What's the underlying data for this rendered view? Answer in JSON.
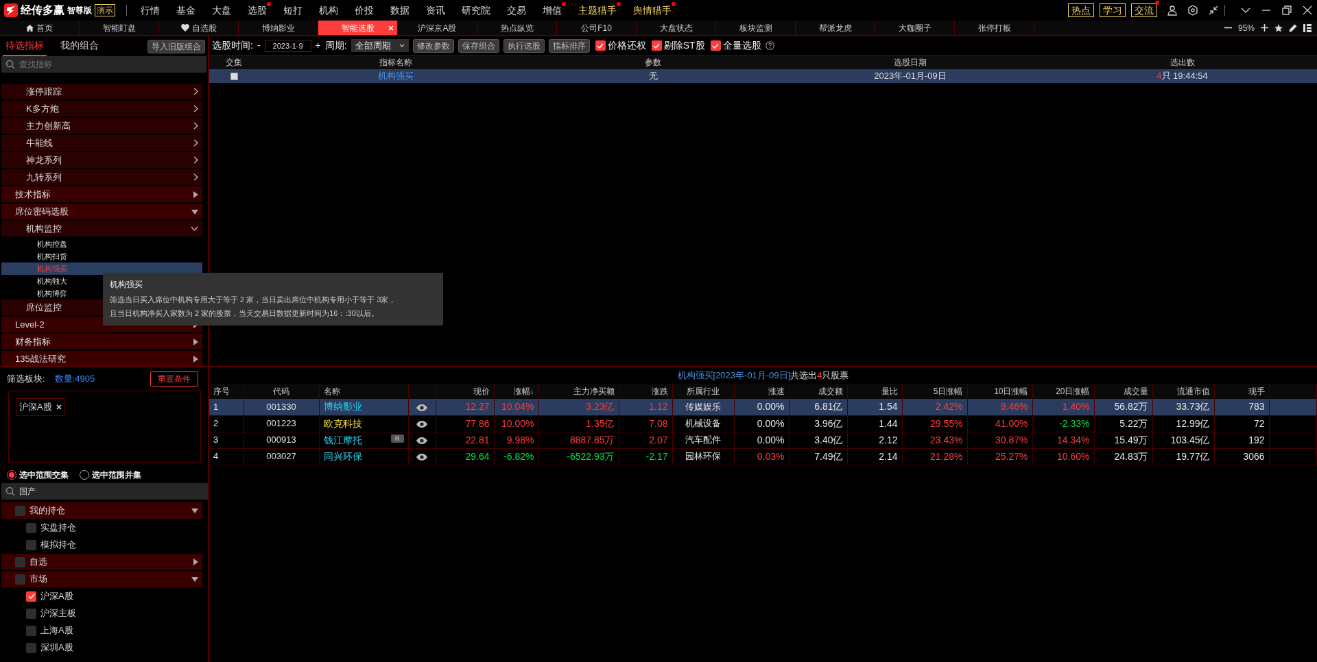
{
  "app": {
    "logo_text": "经传多赢",
    "edition": "智尊版",
    "mode_badge": "演示"
  },
  "menu": [
    {
      "label": "行情",
      "dot": false,
      "highlight": false
    },
    {
      "label": "基金",
      "dot": false,
      "highlight": false
    },
    {
      "label": "大盘",
      "dot": false,
      "highlight": false
    },
    {
      "label": "选股",
      "dot": true,
      "highlight": false
    },
    {
      "label": "短打",
      "dot": false,
      "highlight": false
    },
    {
      "label": "机构",
      "dot": false,
      "highlight": false
    },
    {
      "label": "价投",
      "dot": false,
      "highlight": false
    },
    {
      "label": "数据",
      "dot": false,
      "highlight": false
    },
    {
      "label": "资讯",
      "dot": false,
      "highlight": false
    },
    {
      "label": "研究院",
      "dot": false,
      "highlight": false
    },
    {
      "label": "交易",
      "dot": false,
      "highlight": false
    },
    {
      "label": "增值",
      "dot": true,
      "highlight": false
    },
    {
      "label": "主题猎手",
      "dot": true,
      "highlight": true
    },
    {
      "label": "舆情猎手",
      "dot": true,
      "highlight": true
    }
  ],
  "quick_links": [
    {
      "label": "热点",
      "dot": false
    },
    {
      "label": "学习",
      "dot": false
    },
    {
      "label": "交流",
      "dot": true
    }
  ],
  "tabs": [
    {
      "label": "首页",
      "kind": "home",
      "selected": false
    },
    {
      "label": "智能盯盘",
      "kind": "plain",
      "selected": false
    },
    {
      "label": "自选股",
      "kind": "favorite",
      "selected": false
    },
    {
      "label": "博纳影业",
      "kind": "plain",
      "selected": false
    },
    {
      "label": "智能选股",
      "kind": "plain",
      "selected": true
    },
    {
      "label": "沪深京A股",
      "kind": "plain",
      "selected": false
    },
    {
      "label": "热点纵览",
      "kind": "plain",
      "selected": false
    },
    {
      "label": "公司F10",
      "kind": "plain",
      "selected": false
    },
    {
      "label": "大盘状态",
      "kind": "plain",
      "selected": false
    },
    {
      "label": "板块监测",
      "kind": "plain",
      "selected": false
    },
    {
      "label": "帮派龙虎",
      "kind": "plain",
      "selected": false
    },
    {
      "label": "大咖圈子",
      "kind": "plain",
      "selected": false
    },
    {
      "label": "张停打板",
      "kind": "plain",
      "selected": false
    }
  ],
  "zoom": {
    "reading": "95%"
  },
  "left_tabs": [
    {
      "label": "待选指标",
      "selected": true
    },
    {
      "label": "我的组合",
      "selected": false
    }
  ],
  "import_button": "导入旧版组合",
  "indicator_search": {
    "placeholder": "查找指标"
  },
  "tree": [
    {
      "children": [
        {
          "label": "涨停跟踪",
          "expanded": false
        },
        {
          "label": "K多方炮",
          "expanded": false
        },
        {
          "label": "主力创新高",
          "expanded": false
        },
        {
          "label": "牛能线",
          "expanded": false
        },
        {
          "label": "神龙系列",
          "expanded": false
        },
        {
          "label": "九转系列",
          "expanded": false
        }
      ]
    },
    {
      "label": "技术指标",
      "expanded": false
    },
    {
      "label": "席位密码选股",
      "expanded": true,
      "children": [
        {
          "label": "机构监控",
          "expanded": true,
          "children": [
            {
              "label": "机构控盘",
              "selected": false
            },
            {
              "label": "机构扫货",
              "selected": false
            },
            {
              "label": "机构强买",
              "selected": true
            },
            {
              "label": "机构独大",
              "selected": false
            },
            {
              "label": "机构博弈",
              "selected": false
            }
          ]
        },
        {
          "label": "席位监控"
        }
      ]
    },
    {
      "label": "Level-2",
      "expanded": false
    },
    {
      "label": "财务指标",
      "expanded": false
    },
    {
      "label": "135战法研究",
      "expanded": false
    }
  ],
  "tooltip": {
    "title": "机构强买",
    "lines": [
      "筛选当日买入席位中机构专用大于等于 2 家，当日卖出席位中机构专用小于等于 3家，",
      "且当日机构净买入家数为 2 家的股票，当天交易日数据更新时间为16：:30以后。"
    ]
  },
  "filter": {
    "label": "筛选板块:",
    "count": "数量:4905",
    "reset_button": "重置条件",
    "tags": [
      "沪深A股"
    ],
    "modes": [
      {
        "label": "选中范围交集",
        "selected": true
      },
      {
        "label": "选中范围并集",
        "selected": false
      }
    ],
    "search": {
      "value": "国产"
    },
    "groups": [
      {
        "label": "我的持仓",
        "checked": false,
        "expanded": true,
        "children": [
          {
            "label": "实盘持仓",
            "checked": false
          },
          {
            "label": "模拟持仓",
            "checked": false
          }
        ]
      },
      {
        "label": "自选",
        "checked": false,
        "expanded": false
      },
      {
        "label": "市场",
        "checked": false,
        "expanded": true,
        "children": [
          {
            "label": "沪深A股",
            "checked": true
          },
          {
            "label": "沪深主板",
            "checked": false
          },
          {
            "label": "上海A股",
            "checked": false
          },
          {
            "label": "深圳A股",
            "checked": false
          }
        ]
      }
    ]
  },
  "toolbar": {
    "date_label": "选股时间:",
    "minus": "-",
    "date": "2023-1-9",
    "plus": "+",
    "period_label": "周期:",
    "period": "全部周期",
    "buttons": [
      "修改参数",
      "保存组合",
      "执行选股",
      "指标排序"
    ],
    "options": [
      {
        "label": "价格还权",
        "checked": true
      },
      {
        "label": "剔除ST股",
        "checked": true
      },
      {
        "label": "全量选股",
        "checked": true
      }
    ]
  },
  "strategy_table": {
    "columns": [
      "交集",
      "指标名称",
      "参数",
      "选股日期",
      "选出数"
    ],
    "rows": [
      {
        "selected": true,
        "checked": false,
        "name": "机构强买",
        "params": "无",
        "date": "2023年-01月-09日",
        "count": "4",
        "count_unit": "只",
        "time": "19:44:54"
      }
    ]
  },
  "result_table": {
    "caption": {
      "title": "机构强买[2023年-01月-09日]",
      "prefix": "共选出",
      "count": "4",
      "suffix": "只股票"
    },
    "columns": [
      {
        "label": "序号",
        "kind": "index"
      },
      {
        "label": "代码",
        "kind": "code"
      },
      {
        "label": "名称",
        "kind": "name"
      },
      {
        "kind": "eye"
      },
      {
        "label": "现价",
        "kind": "value"
      },
      {
        "label": "涨幅↓",
        "kind": "value"
      },
      {
        "label": "主力净买额",
        "kind": "value"
      },
      {
        "label": "涨跌",
        "kind": "value"
      },
      {
        "label": "所属行业",
        "kind": "industry"
      },
      {
        "label": "涨速",
        "kind": "value"
      },
      {
        "label": "成交额",
        "kind": "value"
      },
      {
        "label": "量比",
        "kind": "value"
      },
      {
        "label": "5日涨幅",
        "kind": "value"
      },
      {
        "label": "10日涨幅",
        "kind": "value"
      },
      {
        "label": "20日涨幅",
        "kind": "value"
      },
      {
        "label": "成交量",
        "kind": "value"
      },
      {
        "label": "流通市值",
        "kind": "value"
      },
      {
        "label": "现手",
        "kind": "value"
      }
    ],
    "rows": [
      {
        "selected": true,
        "index": "1",
        "code": "001330",
        "name": "博纳影业",
        "color": "#2ed3f0",
        "industry": "传媒娱乐",
        "values": [
          {
            "text": "12.27",
            "color": "#ff3c3c"
          },
          {
            "text": "10.04%",
            "color": "#ff3c3c"
          },
          {
            "text": "3.23亿",
            "color": "#ff3c3c"
          },
          {
            "text": "1.12",
            "color": "#ff3c3c"
          },
          {
            "text": "0.00%",
            "color": "#e6e6e6"
          },
          {
            "text": "6.81亿",
            "color": "#e6e6e6"
          },
          {
            "text": "1.54",
            "color": "#e6e6e6"
          },
          {
            "text": "2.42%",
            "color": "#ff3c3c"
          },
          {
            "text": "9.46%",
            "color": "#ff3c3c"
          },
          {
            "text": "1.40%",
            "color": "#ff3c3c"
          },
          {
            "text": "56.82万",
            "color": "#e6e6e6"
          },
          {
            "text": "33.73亿",
            "color": "#e6e6e6"
          },
          {
            "text": "783",
            "color": "#e6e6e6"
          }
        ]
      },
      {
        "selected": false,
        "index": "2",
        "code": "001223",
        "name": "欧克科技",
        "color": "#f0e040",
        "industry": "机械设备",
        "values": [
          {
            "text": "77.86",
            "color": "#ff3c3c"
          },
          {
            "text": "10.00%",
            "color": "#ff3c3c"
          },
          {
            "text": "1.35亿",
            "color": "#ff3c3c"
          },
          {
            "text": "7.08",
            "color": "#ff3c3c"
          },
          {
            "text": "0.00%",
            "color": "#e6e6e6"
          },
          {
            "text": "3.96亿",
            "color": "#e6e6e6"
          },
          {
            "text": "1.44",
            "color": "#e6e6e6"
          },
          {
            "text": "29.55%",
            "color": "#ff3c3c"
          },
          {
            "text": "41.00%",
            "color": "#ff3c3c"
          },
          {
            "text": "-2.33%",
            "color": "#00e040"
          },
          {
            "text": "5.22万",
            "color": "#e6e6e6"
          },
          {
            "text": "12.99亿",
            "color": "#e6e6e6"
          },
          {
            "text": "72",
            "color": "#e6e6e6"
          }
        ]
      },
      {
        "selected": false,
        "index": "3",
        "code": "000913",
        "name": "钱江摩托",
        "color": "#2ed3f0",
        "badge": "R",
        "industry": "汽车配件",
        "values": [
          {
            "text": "22.81",
            "color": "#ff3c3c"
          },
          {
            "text": "9.98%",
            "color": "#ff3c3c"
          },
          {
            "text": "8887.85万",
            "color": "#ff3c3c"
          },
          {
            "text": "2.07",
            "color": "#ff3c3c"
          },
          {
            "text": "0.00%",
            "color": "#e6e6e6"
          },
          {
            "text": "3.40亿",
            "color": "#e6e6e6"
          },
          {
            "text": "2.12",
            "color": "#e6e6e6"
          },
          {
            "text": "23.43%",
            "color": "#ff3c3c"
          },
          {
            "text": "30.87%",
            "color": "#ff3c3c"
          },
          {
            "text": "14.34%",
            "color": "#ff3c3c"
          },
          {
            "text": "15.49万",
            "color": "#e6e6e6"
          },
          {
            "text": "103.45亿",
            "color": "#e6e6e6"
          },
          {
            "text": "192",
            "color": "#e6e6e6"
          }
        ]
      },
      {
        "selected": false,
        "index": "4",
        "code": "003027",
        "name": "同兴环保",
        "color": "#2ed3f0",
        "industry": "园林环保",
        "values": [
          {
            "text": "29.64",
            "color": "#00e040"
          },
          {
            "text": "-6.82%",
            "color": "#00e040"
          },
          {
            "text": "-6522.93万",
            "color": "#00e040"
          },
          {
            "text": "-2.17",
            "color": "#00e040"
          },
          {
            "text": "0.03%",
            "color": "#ff3c3c"
          },
          {
            "text": "7.49亿",
            "color": "#e6e6e6"
          },
          {
            "text": "2.14",
            "color": "#e6e6e6"
          },
          {
            "text": "21.28%",
            "color": "#ff3c3c"
          },
          {
            "text": "25.27%",
            "color": "#ff3c3c"
          },
          {
            "text": "10.60%",
            "color": "#ff3c3c"
          },
          {
            "text": "24.83万",
            "color": "#e6e6e6"
          },
          {
            "text": "19.77亿",
            "color": "#e6e6e6"
          },
          {
            "text": "3066",
            "color": "#e6e6e6"
          }
        ]
      }
    ]
  }
}
